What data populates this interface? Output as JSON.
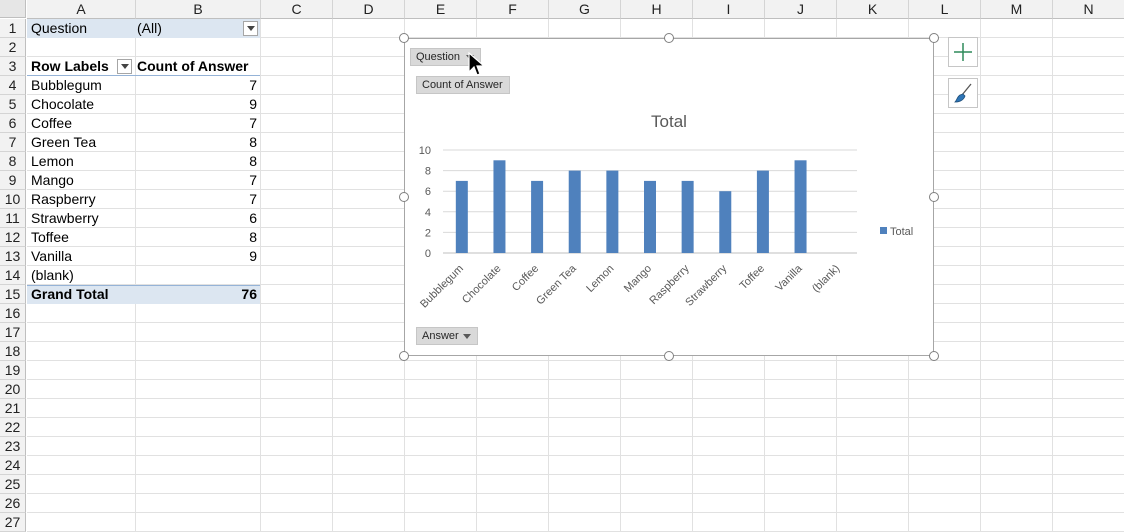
{
  "sheet": {
    "columns": [
      "A",
      "B",
      "C",
      "D",
      "E",
      "F",
      "G",
      "H",
      "I",
      "J",
      "K",
      "L",
      "M",
      "N"
    ],
    "rows": [
      "1",
      "2",
      "3",
      "4",
      "5",
      "6",
      "7",
      "8",
      "9",
      "10",
      "11",
      "12",
      "13",
      "14",
      "15",
      "16",
      "17",
      "18",
      "19",
      "20",
      "21",
      "22",
      "23",
      "24",
      "25",
      "26",
      "27"
    ]
  },
  "pivot": {
    "filter_label": "Question",
    "filter_value": "(All)",
    "row_labels_header": "Row Labels",
    "count_header": "Count of Answer",
    "items": [
      {
        "label": "Bubblegum",
        "value": "7"
      },
      {
        "label": "Chocolate",
        "value": "9"
      },
      {
        "label": "Coffee",
        "value": "7"
      },
      {
        "label": "Green Tea",
        "value": "8"
      },
      {
        "label": "Lemon",
        "value": "8"
      },
      {
        "label": "Mango",
        "value": "7"
      },
      {
        "label": "Raspberry",
        "value": "7"
      },
      {
        "label": "Strawberry",
        "value": "6"
      },
      {
        "label": "Toffee",
        "value": "8"
      },
      {
        "label": "Vanilla",
        "value": "9"
      },
      {
        "label": "(blank)",
        "value": ""
      }
    ],
    "grand_total_label": "Grand Total",
    "grand_total_value": "76"
  },
  "chart_buttons": {
    "question": "Question",
    "count": "Count of Answer",
    "answer": "Answer"
  },
  "chart_data": {
    "type": "bar",
    "title": "Total",
    "categories": [
      "Bubblegum",
      "Chocolate",
      "Coffee",
      "Green Tea",
      "Lemon",
      "Mango",
      "Raspberry",
      "Strawberry",
      "Toffee",
      "Vanilla",
      "(blank)"
    ],
    "series": [
      {
        "name": "Total",
        "values": [
          7,
          9,
          7,
          8,
          8,
          7,
          7,
          6,
          8,
          9,
          null
        ],
        "color": "#4f81bd"
      }
    ],
    "yticks": [
      "0",
      "2",
      "4",
      "6",
      "8",
      "10"
    ],
    "ylim": [
      0,
      10
    ],
    "grid": true,
    "legend": "right"
  },
  "colors": {
    "accent": "#4f81bd",
    "pivot_band": "#dce6f1"
  }
}
